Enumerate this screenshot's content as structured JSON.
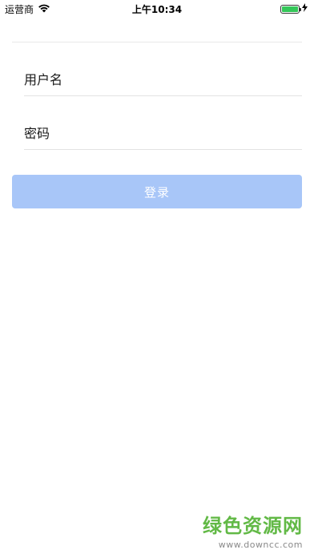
{
  "status_bar": {
    "carrier": "运营商",
    "time": "上午10:34",
    "battery_level": 1.0,
    "icons": [
      "wifi-icon",
      "battery-icon",
      "charging-bolt-icon"
    ]
  },
  "form": {
    "username_placeholder": "用户名",
    "password_placeholder": "密码",
    "username_value": "",
    "password_value": ""
  },
  "login_button": {
    "label": "登录",
    "color": "#a8c6f8",
    "enabled": false
  },
  "watermark": {
    "title": "绿色资源网",
    "url": "www.downcc.com",
    "color": "#62b946"
  }
}
